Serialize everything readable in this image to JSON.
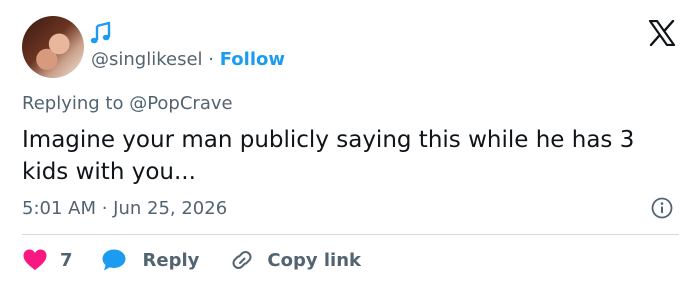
{
  "author": {
    "handle": "@singlikesel",
    "separator": "·",
    "follow_label": "Follow"
  },
  "reply_context": {
    "text": "Replying to @PopCrave"
  },
  "tweet": {
    "text": "Imagine your man publicly saying this while he has 3 kids with you...",
    "timestamp": "5:01 AM · Jun 25, 2026"
  },
  "actions": {
    "like_count": "7",
    "reply_label": "Reply",
    "copy_label": "Copy link"
  },
  "icons": {
    "music": "music-note-icon",
    "brand": "x-logo-icon",
    "info": "info-icon",
    "like": "heart-icon",
    "reply": "speech-bubble-icon",
    "copy": "link-icon"
  },
  "colors": {
    "accent": "#1d9bf0",
    "like": "#f91880",
    "muted": "#536471",
    "text": "#0f1419"
  }
}
